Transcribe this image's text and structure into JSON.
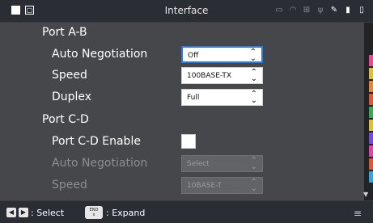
{
  "header": {
    "title": "Interface"
  },
  "sections": {
    "port_ab": {
      "label": "Port A-B",
      "auto_negotiation": {
        "label": "Auto Negotiation",
        "value": "Off"
      },
      "speed": {
        "label": "Speed",
        "value": "100BASE-TX"
      },
      "duplex": {
        "label": "Duplex",
        "value": "Full"
      }
    },
    "port_cd": {
      "label": "Port C-D",
      "enable": {
        "label": "Port C-D Enable",
        "checked": false
      },
      "auto_negotiation": {
        "label": "Auto Negotiation",
        "value": "Select"
      },
      "speed": {
        "label": "Speed",
        "value": "10BASE-T"
      }
    }
  },
  "footer": {
    "select_hint": ": Select",
    "expand_hint": ": Expand",
    "end_key": "END",
    "x_key": "x"
  },
  "icons": {
    "status": [
      "monitor-icon",
      "wifi-icon",
      "network-icon",
      "usb-icon",
      "pen-icon",
      "sd-card-icon",
      "battery-icon"
    ],
    "nav_left": "left-arrow-icon",
    "nav_right": "right-arrow-icon",
    "menu": "menu-icon"
  },
  "colors": {
    "accent": "#2b7be0",
    "panel": "#46474a",
    "bar": "#2a2d34"
  }
}
